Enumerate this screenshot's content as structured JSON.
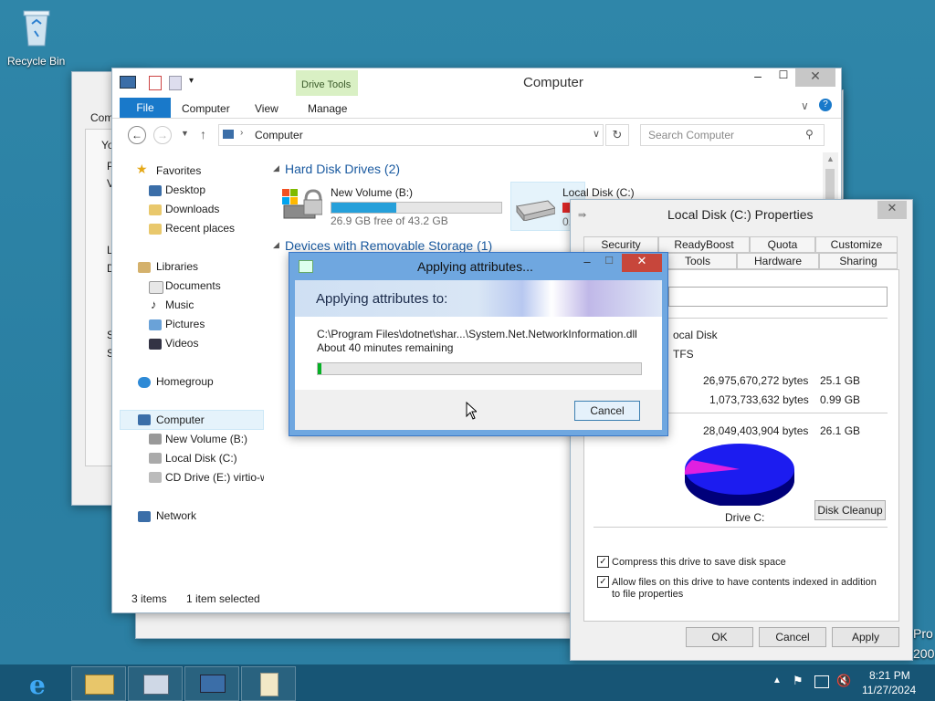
{
  "desktop": {
    "recycle_bin_label": "Recycle Bin",
    "right_edge_text_1": "Pro",
    "right_edge_text_2": "200"
  },
  "back_window": {
    "title_partial": "Comp",
    "side_letters": [
      "Yo",
      "P",
      "V",
      "L",
      "D",
      "S",
      "S"
    ]
  },
  "explorer": {
    "title": "Computer",
    "ribbon_tabs": {
      "file": "File",
      "computer": "Computer",
      "view": "View",
      "manage": "Manage",
      "drive_tools": "Drive Tools"
    },
    "address": "Computer",
    "search_placeholder": "Search Computer",
    "sidebar": {
      "favorites": "Favorites",
      "desktop": "Desktop",
      "downloads": "Downloads",
      "recent": "Recent places",
      "libraries": "Libraries",
      "documents": "Documents",
      "music": "Music",
      "pictures": "Pictures",
      "videos": "Videos",
      "homegroup": "Homegroup",
      "computer": "Computer",
      "new_volume": "New Volume (B:)",
      "local_disk": "Local Disk (C:)",
      "cd_drive": "CD Drive (E:) virtio-w",
      "network": "Network"
    },
    "group_hdd": "Hard Disk Drives (2)",
    "group_removable": "Devices with Removable Storage (1)",
    "drive_b": {
      "name": "New Volume (B:)",
      "free": "26.9 GB free of 43.2 GB",
      "used_fraction": 0.38
    },
    "drive_c": {
      "name": "Local Disk (C:)",
      "free_partial": "0."
    },
    "status": {
      "items": "3 items",
      "selected": "1 item selected"
    }
  },
  "properties": {
    "title": "Local Disk (C:) Properties",
    "tabs_row1": [
      "Security",
      "ReadyBoost",
      "Quota",
      "Customize"
    ],
    "tabs_row2": [
      "Tools",
      "Hardware",
      "Sharing"
    ],
    "type_partial": "ocal Disk",
    "fs_partial": "TFS",
    "used_bytes": "26,975,670,272 bytes",
    "used_gb": "25.1 GB",
    "free_bytes": "1,073,733,632 bytes",
    "free_gb": "0.99 GB",
    "cap_bytes": "28,049,403,904 bytes",
    "cap_gb": "26.1 GB",
    "drive_label": "Drive C:",
    "disk_cleanup": "Disk Cleanup",
    "compress": "Compress this drive to save disk space",
    "index": "Allow files on this drive to have contents indexed in addition to file properties",
    "ok": "OK",
    "cancel": "Cancel",
    "apply": "Apply"
  },
  "dialog": {
    "title": "Applying attributes...",
    "heading": "Applying attributes to:",
    "path": "C:\\Program Files\\dotnet\\shar...\\System.Net.NetworkInformation.dll",
    "remaining": "About 40 minutes remaining",
    "progress_fraction": 0.01,
    "cancel": "Cancel"
  },
  "taskbar": {
    "time": "8:21 PM",
    "date": "11/27/2024"
  },
  "colors": {
    "accent": "#1979ca",
    "manage_tab": "#d9f0c4",
    "close_red": "#c7463b"
  }
}
